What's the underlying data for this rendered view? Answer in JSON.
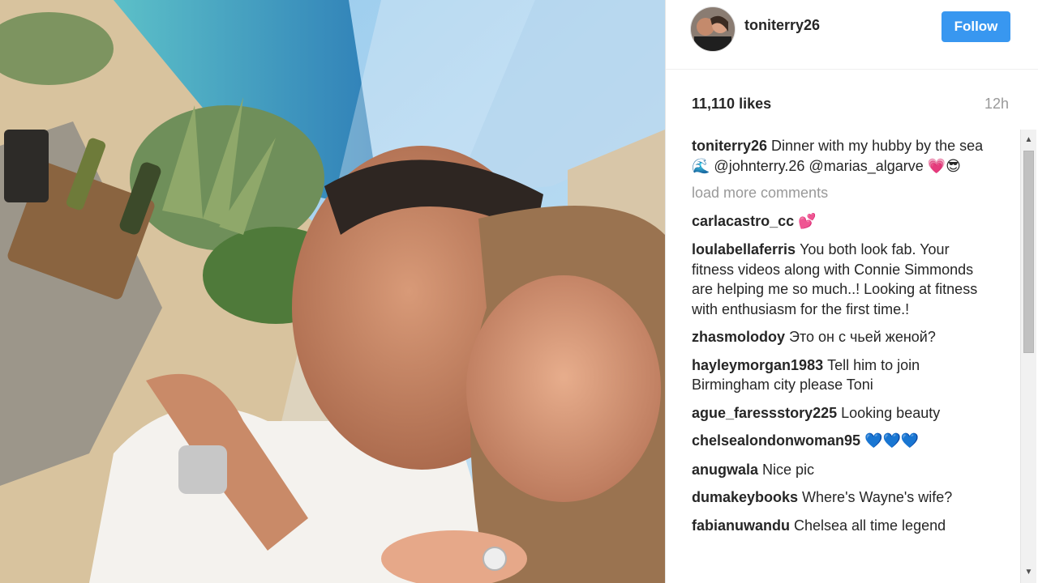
{
  "post": {
    "username": "toniterry26",
    "follow_label": "Follow",
    "likes": "11,110 likes",
    "time": "12h"
  },
  "caption": {
    "user": "toniterry26",
    "text_1": "Dinner with my hubby by the sea ",
    "emoji_wave": "🌊",
    "mention_1": " @johnterry.26 ",
    "mention_2": "@marias_algarve ",
    "emoji_end": "💗😎"
  },
  "load_more": "load more comments",
  "comments": [
    {
      "user": "carlacastro_cc",
      "text": "💕"
    },
    {
      "user": "loulabellaferris",
      "text": "You both look fab. Your fitness videos along with Connie Simmonds are helping me so much..! Looking at fitness with enthusiasm for the first time.!"
    },
    {
      "user": "zhasmolodoy",
      "text": "Это он с чьей женой?"
    },
    {
      "user": "hayleymorgan1983",
      "text": "Tell him to join Birmingham city please Toni"
    },
    {
      "user": "ague_faressstory225",
      "text": "Looking beauty"
    },
    {
      "user": "chelsealondonwoman95",
      "text": "💙💙💙"
    },
    {
      "user": "anugwala",
      "text": "Nice pic"
    },
    {
      "user": "dumakeybooks",
      "text": "Where's Wayne's wife?"
    },
    {
      "user": "fabianuwandu",
      "text": "Chelsea all time legend"
    }
  ],
  "colors": {
    "follow_bg": "#3897f0",
    "muted_text": "#999999",
    "primary_text": "#262626"
  },
  "icons": {
    "scroll_up": "scroll-up-arrow-icon",
    "scroll_down": "scroll-down-arrow-icon"
  }
}
